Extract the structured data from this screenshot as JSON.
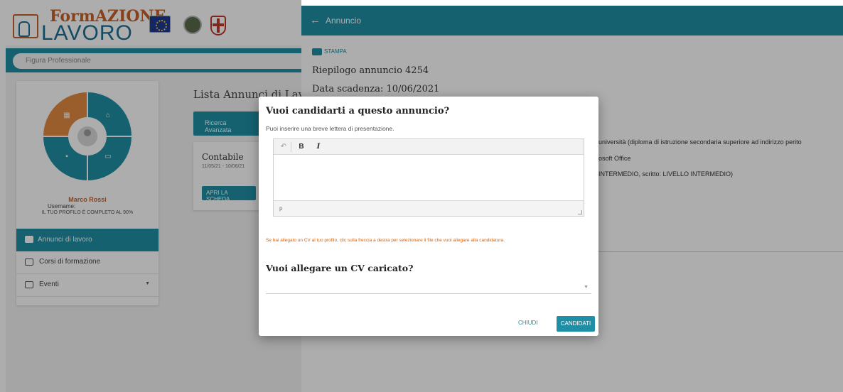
{
  "logo": {
    "text_form": "FormAZIONE",
    "text_lavoro": "LAVORO"
  },
  "search": {
    "placeholder": "Figura Professionale"
  },
  "profile": {
    "name": "Marco Rossi",
    "username_label": "Username:",
    "status": "IL TUO PROFILO È COMPLETO AL 90%"
  },
  "nav": {
    "items": [
      {
        "label": "Annunci di lavoro",
        "icon": "briefcase-icon",
        "active": true
      },
      {
        "label": "Corsi di formazione",
        "icon": "graduation-cap-icon",
        "active": false
      },
      {
        "label": "Eventi",
        "icon": "calendar-icon",
        "active": false
      }
    ]
  },
  "listing": {
    "title": "Lista Annunci di Lavoro",
    "advanced_search": "Ricerca Avanzata",
    "job": {
      "title": "Contabile",
      "dates": "11/05/21 - 10/06/21",
      "open_button": "APRI LA SCHEDA"
    }
  },
  "panel": {
    "title": "Annuncio",
    "print_label": "STAMPA",
    "summary": "Riepilogo annuncio 4254",
    "deadline": "Data scadenza: 10/06/2021",
    "detail_lines": [
      "università (diploma di istruzione secondaria superiore ad indirizzo perito",
      "osoft Office",
      "INTERMEDIO, scritto: LIVELLO INTERMEDIO)"
    ]
  },
  "modal": {
    "title": "Vuoi candidarti a questo annuncio?",
    "subtitle": "Puoi inserire una breve lettera di presentazione.",
    "editor": {
      "path": "p",
      "bold_label": "B",
      "italic_label": "I",
      "undo_symbol": "↶"
    },
    "note": "Se hai allegato un CV al tuo profilo, clic sulla freccia a destra per selezionare il file che vuoi allegare alla candidatura.",
    "cv_heading": "Vuoi allegare un CV caricato?",
    "close_label": "CHIUDI",
    "submit_label": "CANDIDATI"
  },
  "colors": {
    "primary": "#1f8fa5",
    "accent_orange": "#e38b43",
    "warning_text": "#e06000"
  }
}
